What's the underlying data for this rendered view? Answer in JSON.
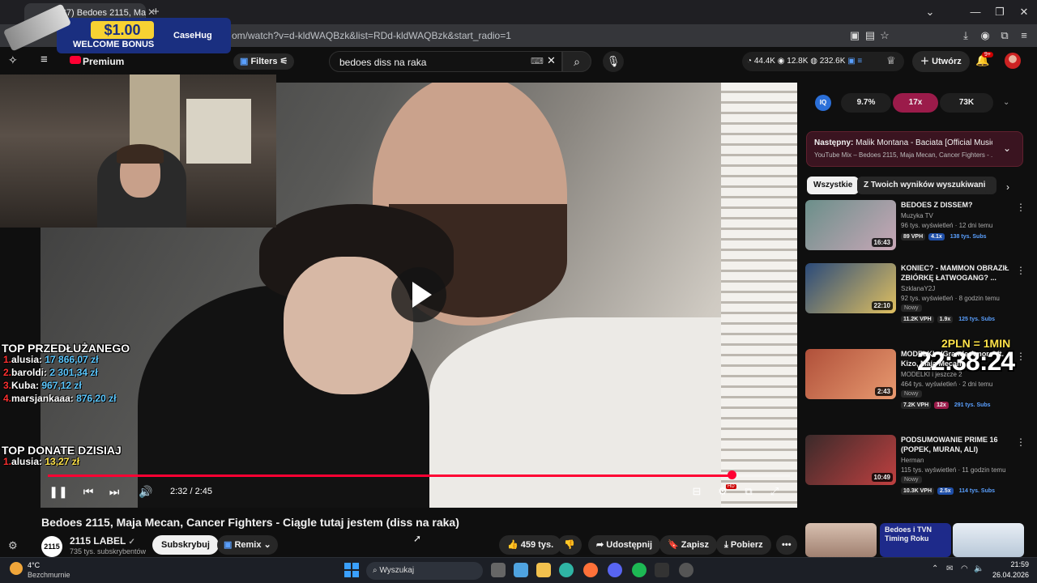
{
  "browser": {
    "tab_title": "(367) Bedoes 2115, Maja M",
    "url": "om/watch?v=d-kldWAQBzk&list=RDd-kldWAQBzk&start_radio=1"
  },
  "promo": {
    "price": "$1.00",
    "subtitle": "WELCOME BONUS",
    "brand": "CaseHug"
  },
  "youtube": {
    "premium_label": "Premium",
    "filters_label": "Filters",
    "search_query": "bedoes diss na raka",
    "stats": {
      "a": "44.4K",
      "b": "12.8K",
      "c": "232.6K"
    },
    "create_label": "Utwórz",
    "notif_badge": "9+"
  },
  "player": {
    "current_time": "2:32",
    "duration": "2:45",
    "time_display": "2:32 / 2:45",
    "progress_fraction": 0.921,
    "settings_badge": "HD"
  },
  "overlay": {
    "top_extended_title": "TOP PRZEDŁUŻANEGO",
    "top_extended": [
      {
        "num": "1.",
        "name": "alusia:",
        "value": "17 866,07 zł"
      },
      {
        "num": "2.",
        "name": "baroldi:",
        "value": "2 301,34 zł"
      },
      {
        "num": "3.",
        "name": "Kuba:",
        "value": "967,12 zł"
      },
      {
        "num": "4.",
        "name": "marsjankaaa:",
        "value": "876,20 zł"
      }
    ],
    "top_donate_title": "TOP DONATE DZISIAJ",
    "top_donate": [
      {
        "num": "1.",
        "name": "alusia:",
        "value": "13,27 zł"
      }
    ],
    "rate": "2PLN = 1MIN",
    "timer": "22:38:24"
  },
  "video": {
    "title": "Bedoes 2115, Maja Mecan, Cancer Fighters - Ciągle tutaj jestem (diss na raka)",
    "channel": "2115 LABEL",
    "channel_avatar": "2115",
    "subscribers": "735 tys. subskrybentów",
    "subscribe_label": "Subskrybuj",
    "remix_label": "Remix",
    "likes": "459 tys.",
    "share_label": "Udostępnij",
    "save_label": "Zapisz",
    "download_label": "Pobierz"
  },
  "sidebar": {
    "iq_logo": "IQ",
    "iq_values": [
      "9.7%",
      "17x",
      "73K"
    ],
    "next_label": "Następny:",
    "next_title": "Malik Montana - Baciata [Official Music ...",
    "next_sub": "YouTube Mix – Bedoes 2115, Maja Mecan, Cancer Fighters - ...",
    "chips": [
      "Wszystkie",
      "Z Twoich wyników wyszukiwania"
    ],
    "recommendations": [
      {
        "title": "BEDOES Z DISSEM?",
        "channel": "Muzyka TV",
        "meta": "96 tys. wyświetleń · 12 dni temu",
        "duration": "16:43",
        "new": "",
        "stats": [
          "89 VPH",
          "4.1x",
          "138 tys. Subs"
        ],
        "colors": [
          "#6b8f8a",
          "#c8a7b7"
        ]
      },
      {
        "title": "KONIEC? - MAMMON OBRAZIŁ ZBIÓRKĘ ŁATWOGANG? ...",
        "channel": "SzklanaY2J",
        "meta": "92 tys. wyświetleń · 8 godzin temu",
        "duration": "22:10",
        "new": "Nowy",
        "stats": [
          "11.2K VPH",
          "1.9x",
          "125 tys. Subs"
        ],
        "colors": [
          "#2a4a7a",
          "#e0c060"
        ]
      },
      {
        "title": "MODELKI - 'Grande Amore' ft. Kizo, Maja Mecan",
        "channel": "MODELKI i jeszcze 2",
        "meta": "464 tys. wyświetleń · 2 dni temu",
        "duration": "2:43",
        "new": "Nowy",
        "stats": [
          "7.2K VPH",
          "12x",
          "291 tys. Subs"
        ],
        "colors": [
          "#b0503a",
          "#e89a70"
        ]
      },
      {
        "title": "PODSUMOWANIE PRIME 16 (POPEK, MURAN, ALI)",
        "channel": "Herman",
        "meta": "115 tys. wyświetleń · 11 godzin temu",
        "duration": "10:49",
        "new": "Nowy",
        "stats": [
          "10.3K VPH",
          "2.5x",
          "114 tys. Subs"
        ],
        "colors": [
          "#3a2a2a",
          "#c04040"
        ]
      }
    ],
    "bottom_thumb_text": "Bedoes i TVN Timing Roku"
  },
  "taskbar": {
    "temp": "4°C",
    "weather": "Bezchmurnie",
    "search_placeholder": "Wyszukaj",
    "time": "21:59",
    "date": "26.04.2026"
  }
}
